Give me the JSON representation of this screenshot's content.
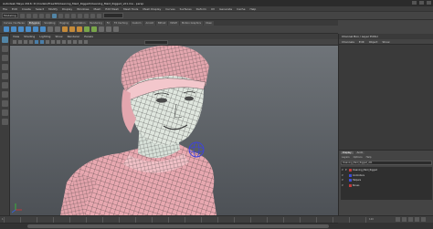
{
  "window": {
    "title": "Autodesk Maya 2016: D:\\models\\Free3D\\Cleaning_Maid_Rigged\\Cleaning_Maid_Rigged_v01.ma - persp",
    "controls": [
      "minimize-icon",
      "maximize-icon",
      "close-icon"
    ]
  },
  "menubar": {
    "items": [
      "File",
      "Edit",
      "Create",
      "Select",
      "Modify",
      "Display",
      "Windows",
      "Mesh",
      "Edit Mesh",
      "Mesh Tools",
      "Mesh Display",
      "Curves",
      "Surfaces",
      "Deform",
      "UV",
      "Generate",
      "Cache",
      "Help"
    ]
  },
  "statusline": {
    "mode": "Modeling"
  },
  "shelf": {
    "tabs": [
      "Curves / Surfaces",
      "Polygons",
      "Sculpting",
      "Rigging",
      "Animation",
      "Rendering",
      "FX",
      "FX Caching",
      "Custom",
      "Arnold",
      "Bifrost",
      "MASH",
      "Motion Graphics",
      "XGen"
    ],
    "active_tab": 1
  },
  "panel": {
    "menu": [
      "View",
      "Shading",
      "Lighting",
      "Show",
      "Renderer",
      "Panels"
    ],
    "camera": "persp"
  },
  "channelbox": {
    "title": "Channel Box / Layer Editor",
    "menu": [
      "Channels",
      "Edit",
      "Object",
      "Show"
    ]
  },
  "layers": {
    "tabs": [
      "Display",
      "Anim"
    ],
    "active_tab": 0,
    "menu": [
      "Layers",
      "Options",
      "Help"
    ],
    "scene_field": "Cleaning_Maid_Rigged_v01",
    "rows": [
      {
        "v": "V",
        "p": "P",
        "color": "#c23c3c",
        "name": "Cleaning_Maid_Rigged"
      },
      {
        "v": "V",
        "p": "",
        "color": "#3d4fd6",
        "name": "Controllers"
      },
      {
        "v": "V",
        "p": "",
        "color": "#3d4fd6",
        "name": "Helpers"
      },
      {
        "v": "V",
        "p": "",
        "color": "#c23c3c",
        "name": "Bones"
      }
    ]
  },
  "timeslider": {
    "start": "1",
    "end": "120"
  }
}
